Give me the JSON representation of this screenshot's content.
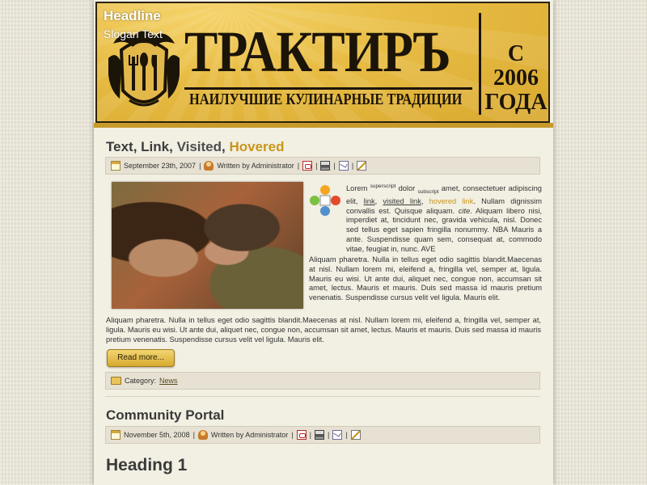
{
  "header": {
    "headline": "Headline",
    "slogan": "Slogan Text",
    "logo_title": "ТРАКТИРЪ",
    "logo_tagline": "НАИЛУЧШИЕ КУЛИНАРНЫЕ ТРАДИЦИИ",
    "since_line1": "С 2006",
    "since_line2": "ГОДА"
  },
  "article1": {
    "title_part1": "Text",
    "title_sep1": ", ",
    "title_link": "Link",
    "title_sep2": ", ",
    "title_visited": "Visited",
    "title_sep3": ", ",
    "title_hovered": "Hovered",
    "date": "September 23th, 2007",
    "written_by": "Written by Administrator",
    "p1_lorem": "Lorem",
    "p1_sup": "superscript",
    "p1_dolor": "dolor",
    "p1_sub": "subscript",
    "p1_after": "amet, consectetuer adipiscing elit,",
    "p1_link": "link",
    "p1_visited": "visited link",
    "p1_hover": "hovered link",
    "p1_rest": ". Nullam dignissim convallis est. Quisque aliquam.",
    "p1_cite": "cite",
    "p1_tail": ". Aliquam libero nisi, imperdiet at, tincidunt nec, gravida vehicula, nisl. Donec sed tellus eget sapien fringilla nonummy. NBA Mauris a ante. Suspendisse quam sem, consequat at, commodo vitae, feugiat in, nunc. AVE",
    "p2": "Aliquam pharetra. Nulla in tellus eget odio sagittis blandit.Maecenas at nisl. Nullam lorem mi, eleifend a, fringilla vel, semper at, ligula. Mauris eu wisi. Ut ante dui, aliquet nec, congue non, accumsan sit amet, lectus. Mauris et mauris. Duis sed massa id mauris pretium venenatis. Suspendisse cursus velit vel ligula. Mauris elit.",
    "p3": "Aliquam pharetra. Nulla in tellus eget odio sagittis blandit.Maecenas at nisl. Nullam lorem mi, eleifend a, fringilla vel, semper at, ligula. Mauris eu wisi. Ut ante dui, aliquet nec, congue non, accumsan sit amet, lectus. Mauris et mauris. Duis sed massa id mauris pretium venenatis. Suspendisse cursus velit vel ligula. Mauris elit.",
    "read_more": "Read more...",
    "category_label": "Category:",
    "category_value": "News"
  },
  "article2": {
    "title": "Community Portal",
    "date": "November 5th, 2008",
    "written_by": "Written by Administrator"
  },
  "heading1": "Heading 1",
  "icons": {
    "calendar": "calendar-icon",
    "author": "user-icon",
    "pdf": "pdf-icon",
    "print": "print-icon",
    "email": "email-icon",
    "edit": "edit-icon",
    "category": "folder-icon",
    "joomla": "joomla-logo-icon"
  },
  "separator": "|",
  "colors": {
    "accent": "#c8961c",
    "header_gold": "#e8bd45",
    "text": "#3a3a3a",
    "page_bg": "#f2efe3"
  }
}
